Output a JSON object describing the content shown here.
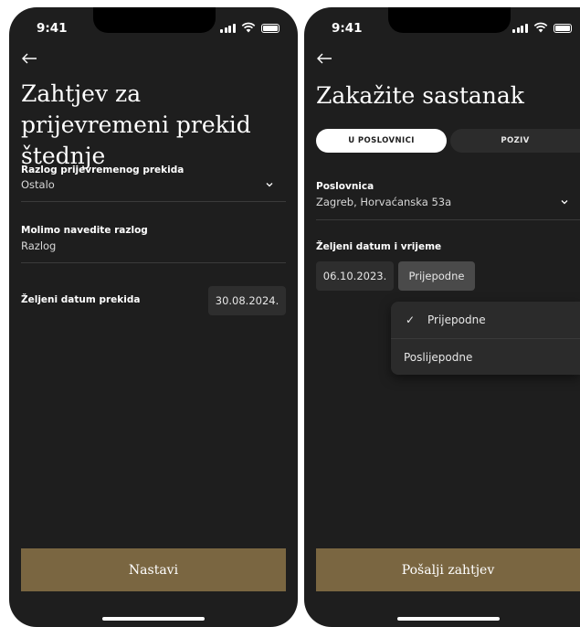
{
  "left_screen": {
    "status_time": "9:41",
    "title": "Zahtjev za prijevremeni prekid štednje",
    "reason_label": "Razlog prijevremenog prekida",
    "reason_value": "Ostalo",
    "explain_label": "Molimo navedite razlog",
    "explain_placeholder": "Razlog",
    "date_label": "Željeni datum prekida",
    "date_value": "30.08.2024.",
    "cta_label": "Nastavi"
  },
  "right_screen": {
    "status_time": "9:41",
    "title": "Zakažite sastanak",
    "tabs": [
      {
        "label": "U POSLOVNICI",
        "selected": true
      },
      {
        "label": "POZIV",
        "selected": false
      }
    ],
    "branch_label": "Poslovnica",
    "branch_value": "Zagreb, Horvaćanska 53a",
    "datetime_label": "Željeni datum i vrijeme",
    "date_value": "06.10.2023.",
    "time_value": "Prijepodne",
    "dropdown_options": [
      {
        "label": "Prijepodne",
        "checked": true
      },
      {
        "label": "Poslijepodne",
        "checked": false
      }
    ],
    "check_mark": "✓",
    "cta_label": "Pošalji zahtjev"
  },
  "colors": {
    "background": "#1e1e1e",
    "accent_gold": "#7a6641",
    "chip": "#2e2e2e"
  }
}
